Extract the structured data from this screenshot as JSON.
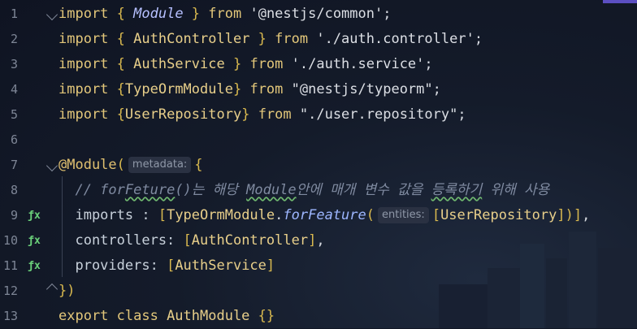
{
  "editor": {
    "lines": [
      {
        "n": "1",
        "segments": [
          [
            "kw",
            "import "
          ],
          [
            "br",
            "{ "
          ],
          [
            "mod",
            "Module"
          ],
          [
            "br",
            " } "
          ],
          [
            "kw",
            "from "
          ],
          [
            "str",
            "'@nestjs/common'"
          ],
          [
            "",
            ";"
          ]
        ]
      },
      {
        "n": "2",
        "segments": [
          [
            "kw",
            "import "
          ],
          [
            "br",
            "{ "
          ],
          [
            "cls",
            "AuthController"
          ],
          [
            "br",
            " } "
          ],
          [
            "kw",
            "from "
          ],
          [
            "str",
            "'./auth.controller'"
          ],
          [
            "",
            ";"
          ]
        ]
      },
      {
        "n": "3",
        "segments": [
          [
            "kw",
            "import "
          ],
          [
            "br",
            "{ "
          ],
          [
            "cls",
            "AuthService"
          ],
          [
            "br",
            " } "
          ],
          [
            "kw",
            "from "
          ],
          [
            "str",
            "'./auth.service'"
          ],
          [
            "",
            ";"
          ]
        ]
      },
      {
        "n": "4",
        "segments": [
          [
            "kw",
            "import "
          ],
          [
            "br",
            "{"
          ],
          [
            "cls",
            "TypeOrmModule"
          ],
          [
            "br",
            "} "
          ],
          [
            "kw",
            "from "
          ],
          [
            "str",
            "\"@nestjs/typeorm\""
          ],
          [
            "",
            ";"
          ]
        ]
      },
      {
        "n": "5",
        "segments": [
          [
            "kw",
            "import "
          ],
          [
            "br",
            "{"
          ],
          [
            "cls",
            "UserRepository"
          ],
          [
            "br",
            "} "
          ],
          [
            "kw",
            "from "
          ],
          [
            "str",
            "\"./user.repository\""
          ],
          [
            "",
            ";"
          ]
        ]
      },
      {
        "n": "6",
        "segments": []
      },
      {
        "n": "7",
        "segments": [
          [
            "dec",
            "@Module"
          ],
          [
            "br",
            "("
          ],
          [
            "hint",
            "metadata:"
          ],
          [
            "br",
            "{"
          ]
        ]
      },
      {
        "n": "8",
        "segments": [
          [
            "cmt",
            "  // for"
          ],
          [
            "cmt squig",
            "Feture"
          ],
          [
            "cmt",
            "()는 해당 "
          ],
          [
            "cmt squig",
            "Module"
          ],
          [
            "cmt",
            "안에 매개 변수 값을 "
          ],
          [
            "cmt squig",
            "등록하기"
          ],
          [
            "cmt",
            " 위해 사용"
          ]
        ]
      },
      {
        "n": "9",
        "gutter": "ƒx",
        "segments": [
          [
            "prop",
            "  imports : "
          ],
          [
            "br",
            "["
          ],
          [
            "cls",
            "TypeOrmModule"
          ],
          [
            "",
            "."
          ],
          [
            "fn",
            "forFeature"
          ],
          [
            "br",
            "("
          ],
          [
            "hint",
            "entities:"
          ],
          [
            "br",
            "["
          ],
          [
            "cls",
            "UserRepository"
          ],
          [
            "br",
            "])"
          ],
          [
            "br",
            "]"
          ],
          [
            "",
            ","
          ]
        ]
      },
      {
        "n": "10",
        "gutter": "ƒx",
        "segments": [
          [
            "prop",
            "  controllers: "
          ],
          [
            "br",
            "["
          ],
          [
            "cls",
            "AuthController"
          ],
          [
            "br",
            "]"
          ],
          [
            "",
            ","
          ]
        ]
      },
      {
        "n": "11",
        "gutter": "ƒx",
        "segments": [
          [
            "prop",
            "  providers: "
          ],
          [
            "br",
            "["
          ],
          [
            "cls",
            "AuthService"
          ],
          [
            "br",
            "]"
          ]
        ]
      },
      {
        "n": "12",
        "segments": [
          [
            "br",
            "})"
          ]
        ]
      },
      {
        "n": "13",
        "segments": [
          [
            "kw",
            "export class "
          ],
          [
            "cls",
            "AuthModule "
          ],
          [
            "br",
            "{}"
          ]
        ]
      }
    ]
  }
}
